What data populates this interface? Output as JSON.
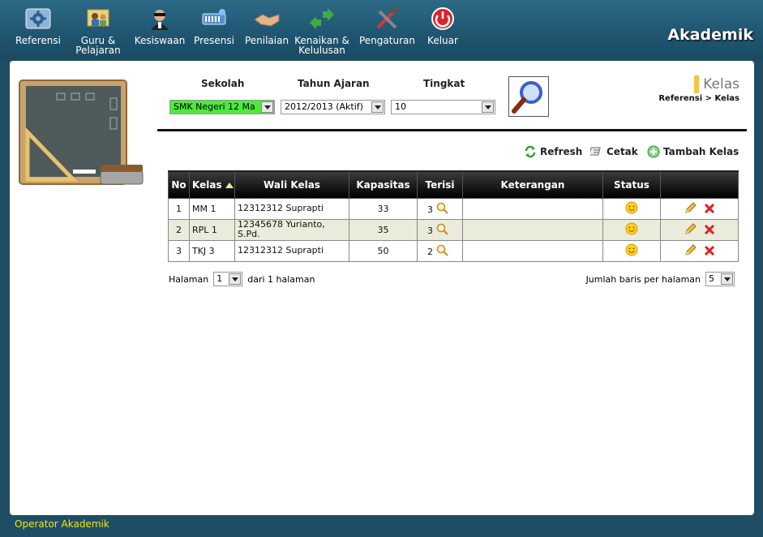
{
  "app_title": "Akademik",
  "nav": [
    {
      "label": "Referensi",
      "icon": "gear-icon"
    },
    {
      "label": "Guru &\nPelajaran",
      "icon": "teacher-icon"
    },
    {
      "label": "Kesiswaan",
      "icon": "student-icon"
    },
    {
      "label": "Presensi",
      "icon": "attendance-icon"
    },
    {
      "label": "Penilaian",
      "icon": "handshake-icon"
    },
    {
      "label": "Kenaikan &\nKelulusan",
      "icon": "arrows-icon"
    },
    {
      "label": "Pengaturan",
      "icon": "tools-icon"
    },
    {
      "label": "Keluar",
      "icon": "power-icon"
    }
  ],
  "filters": {
    "sekolah_label": "Sekolah",
    "sekolah_value": "SMK Negeri 12 Ma",
    "tahun_label": "Tahun Ajaran",
    "tahun_value": "2012/2013 (Aktif)",
    "tingkat_label": "Tingkat",
    "tingkat_value": "10"
  },
  "page": {
    "title": "Kelas",
    "breadcrumb": "Referensi >  Kelas"
  },
  "toolbar": {
    "refresh": "Refresh",
    "cetak": "Cetak",
    "tambah": "Tambah Kelas"
  },
  "table": {
    "headers": [
      "No",
      "Kelas",
      "Wali Kelas",
      "Kapasitas",
      "Terisi",
      "Keterangan",
      "Status",
      ""
    ],
    "rows": [
      {
        "no": "1",
        "kelas": "MM 1",
        "wali": "12312312 Suprapti",
        "kapasitas": "33",
        "terisi": "3",
        "keterangan": ""
      },
      {
        "no": "2",
        "kelas": "RPL 1",
        "wali": "12345678 Yurianto, S.Pd.",
        "kapasitas": "35",
        "terisi": "3",
        "keterangan": ""
      },
      {
        "no": "3",
        "kelas": "TKJ 3",
        "wali": "12312312 Suprapti",
        "kapasitas": "50",
        "terisi": "2",
        "keterangan": ""
      }
    ]
  },
  "pager": {
    "halaman_label": "Halaman",
    "page_value": "1",
    "dari_label": "dari 1 halaman",
    "rows_label": "Jumlah baris per halaman",
    "rows_value": "5"
  },
  "footer": "Operator Akademik",
  "colors": {
    "topbar": "#1f5570",
    "sekolah_bg": "#4dea3c",
    "accent": "#f5c24a",
    "footer_text": "#f2e614"
  }
}
